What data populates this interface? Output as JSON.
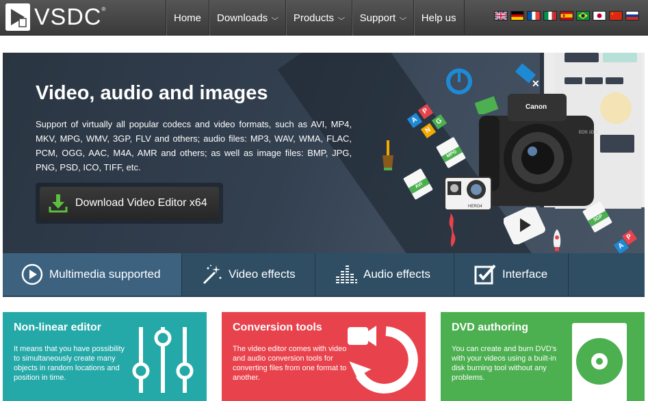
{
  "brand": {
    "name": "VSDC",
    "reg": "®"
  },
  "nav": {
    "items": [
      {
        "label": "Home",
        "dropdown": false
      },
      {
        "label": "Downloads",
        "dropdown": true
      },
      {
        "label": "Products",
        "dropdown": true
      },
      {
        "label": "Support",
        "dropdown": true
      },
      {
        "label": "Help us",
        "dropdown": false
      }
    ],
    "flags": [
      "english",
      "german",
      "french",
      "italian",
      "spanish",
      "portuguese-brazil",
      "japanese",
      "chinese",
      "russian"
    ]
  },
  "hero": {
    "title": "Video, audio and images",
    "description": "Support of virtually all popular codecs and video formats, such as AVI, MP4, MKV, MPG, WMV, 3GP, FLV and others; audio files: MP3, WAV, WMA, FLAC, PCM, OGG, AAC, M4A, AMR and others; as well as image files: BMP, JPG, PNG, PSD, ICO, TIFF, etc.",
    "download_button": "Download Video Editor x64",
    "art_labels": {
      "mpg": "MPG",
      "avi": "AVI",
      "gp3": "3GP",
      "camera": "Canon",
      "model": "EOS 1D X",
      "hero": "HERO4",
      "a": "A",
      "p": "P",
      "n": "N",
      "g": "G"
    }
  },
  "tabs": [
    {
      "label": "Multimedia supported",
      "icon": "play-circle-icon",
      "active": true
    },
    {
      "label": "Video effects",
      "icon": "magic-wand-icon",
      "active": false
    },
    {
      "label": "Audio effects",
      "icon": "equalizer-icon",
      "active": false
    },
    {
      "label": "Interface",
      "icon": "checkbox-edit-icon",
      "active": false
    }
  ],
  "cards": [
    {
      "title": "Non-linear editor",
      "text": "It means that you have possibility to simultaneously create many objects in random locations and position in time.",
      "color": "#25a9a8",
      "icon": "sliders-icon"
    },
    {
      "title": "Conversion tools",
      "text": "The video editor comes with video and audio conversion tools for converting files from one format to another.",
      "color": "#e8434d",
      "icon": "convert-camera-icon"
    },
    {
      "title": "DVD authoring",
      "text": "You can create and burn DVD's with your videos using a built-in disk burning tool without any problems.",
      "color": "#4caf50",
      "icon": "disc-icon"
    }
  ],
  "colors": {
    "nav_bg": "#444444",
    "tab_bar": "#2f4e64",
    "tab_active": "#3c6280",
    "download_green": "#4caf50"
  }
}
